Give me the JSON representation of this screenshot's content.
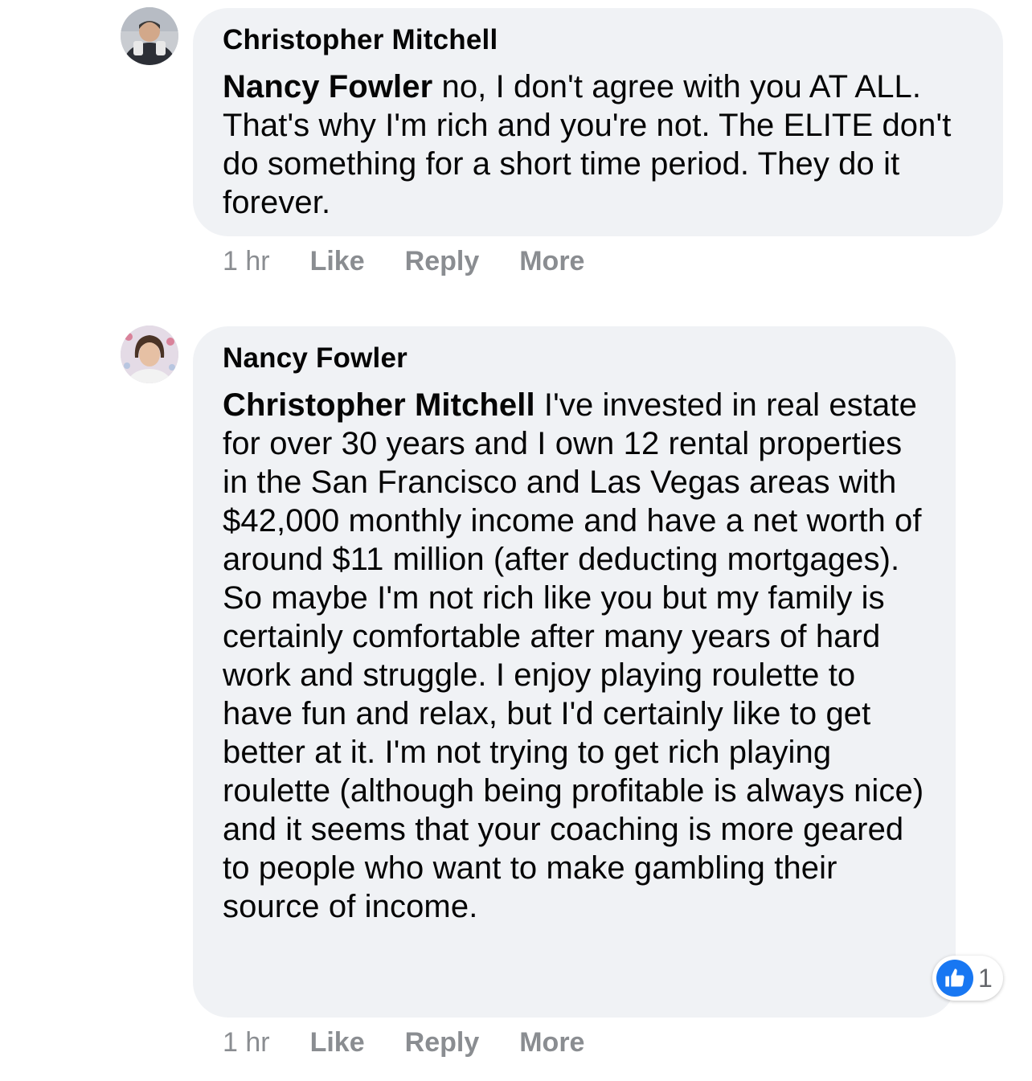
{
  "comments": [
    {
      "author": "Christopher Mitchell",
      "mention": "Nancy Fowler",
      "body": " no, I don't agree with you AT ALL. That's why I'm rich and you're not. The ELITE don't do something for a short time period. They do it forever.",
      "time": "1 hr",
      "like_label": "Like",
      "reply_label": "Reply",
      "more_label": "More"
    },
    {
      "author": "Nancy Fowler",
      "mention": "Christopher Mitchell",
      "body": " I've invested in real estate for over 30 years and I own 12 rental properties in the San Francisco and Las Vegas areas with $42,000 monthly income and have a net worth of around $11 million (after deducting mortgages). So maybe I'm not rich like you but my family is certainly comfortable after many years of hard work and struggle. I enjoy playing roulette to have fun and relax, but I'd certainly like to get better at it. I'm not trying to get rich playing roulette (although being profitable is always nice) and it seems that your coaching is more geared to people who want to make gambling their source of income.",
      "time": "1 hr",
      "like_label": "Like",
      "reply_label": "Reply",
      "more_label": "More",
      "reaction": {
        "icon": "thumbs-up-icon",
        "count": "1"
      }
    }
  ],
  "colors": {
    "bubble": "#f0f2f5",
    "meta_text": "#8a8d91",
    "like_blue": "#1877f2"
  }
}
